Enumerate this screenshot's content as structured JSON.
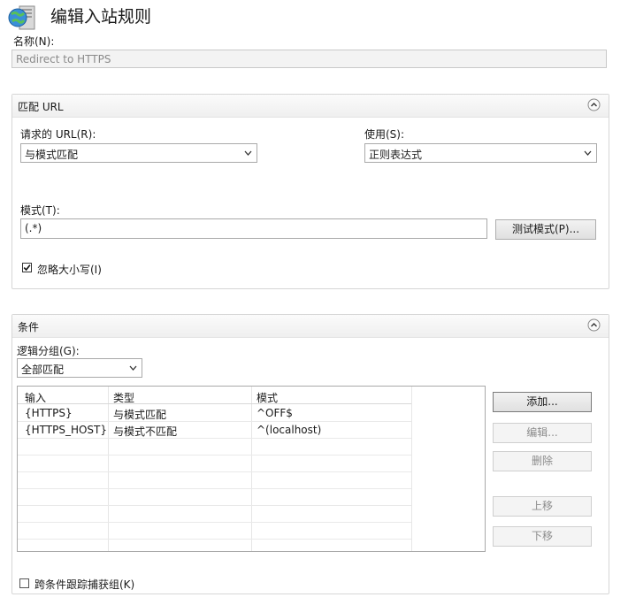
{
  "header": {
    "title": "编辑入站规则"
  },
  "name": {
    "label": "名称(N):",
    "value": "Redirect to HTTPS"
  },
  "match_url": {
    "title": "匹配 URL",
    "requested_url_label": "请求的 URL(R):",
    "requested_url_value": "与模式匹配",
    "using_label": "使用(S):",
    "using_value": "正则表达式",
    "pattern_label": "模式(T):",
    "pattern_value": "(.*)",
    "test_button": "测试模式(P)...",
    "ignore_case_label": "忽略大小写(I)",
    "ignore_case_checked": true
  },
  "conditions": {
    "title": "条件",
    "logical_grouping_label": "逻辑分组(G):",
    "logical_grouping_value": "全部匹配",
    "columns": [
      "输入",
      "类型",
      "模式"
    ],
    "rows": [
      [
        "{HTTPS}",
        "与模式匹配",
        "^OFF$"
      ],
      [
        "{HTTPS_HOST}",
        "与模式不匹配",
        "^(localhost)"
      ]
    ],
    "buttons": {
      "add": "添加...",
      "edit": "编辑...",
      "remove": "删除",
      "move_up": "上移",
      "move_down": "下移"
    },
    "track_captures_label": "跨条件跟踪捕获组(K)",
    "track_captures_checked": false
  }
}
